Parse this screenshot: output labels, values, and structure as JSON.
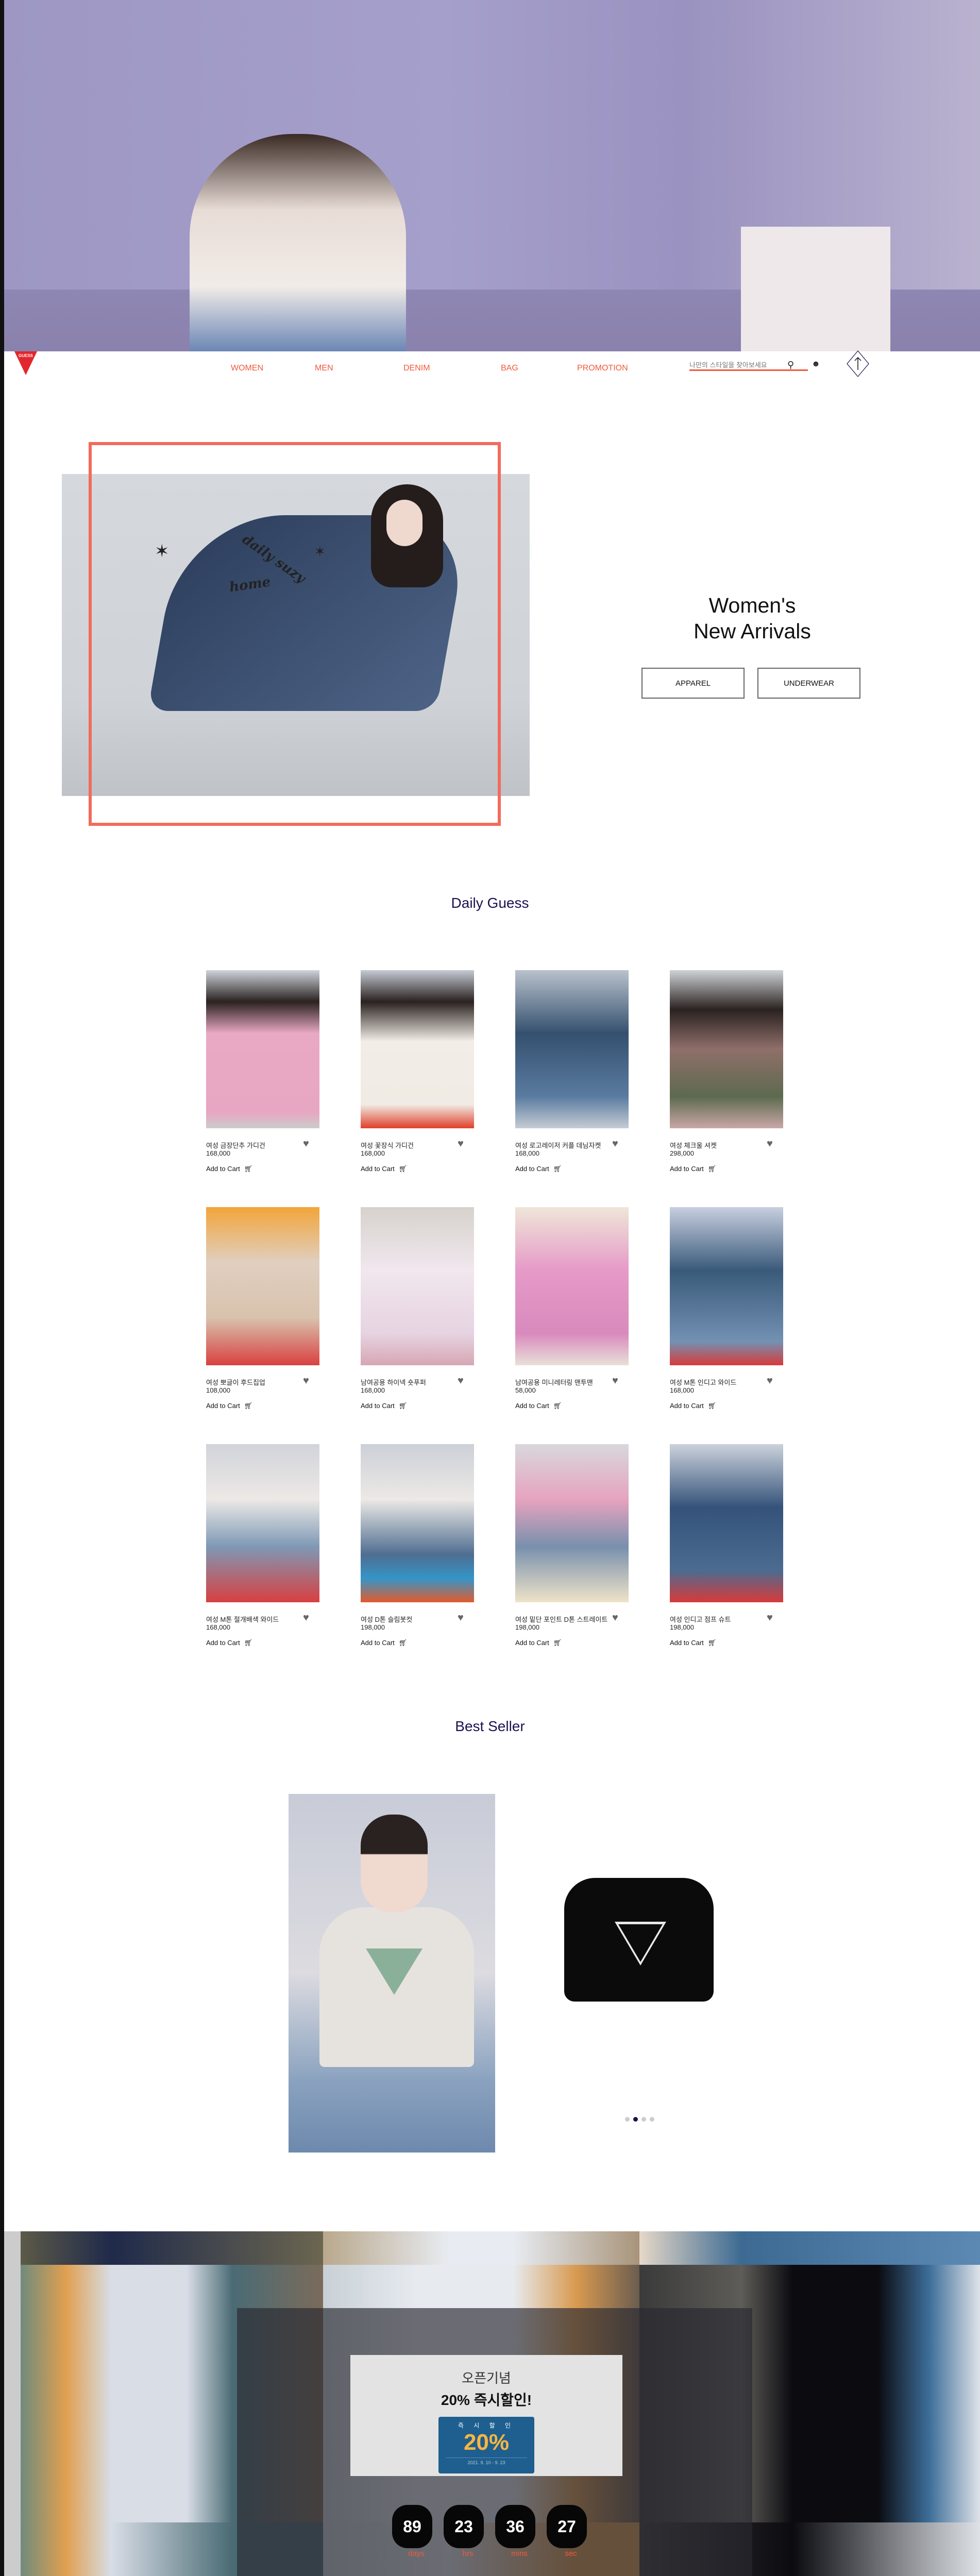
{
  "nav": {
    "logo_text": "GUESS",
    "items": [
      "WOMEN",
      "MEN",
      "DENIM",
      "BAG",
      "PROMOTION"
    ],
    "search_placeholder": "나만의 스타일을 찾아보세요",
    "icons": [
      "search-icon",
      "user-icon",
      "scroll-top-icon"
    ]
  },
  "hero": {
    "script_text_1": "daily suzy",
    "script_text_2": "home",
    "title_line1": "Women's",
    "title_line2": "New Arrivals",
    "buttons": [
      "APPAREL",
      "UNDERWEAR"
    ],
    "frame_color": "#f26b5b"
  },
  "daily": {
    "title": "Daily Guess",
    "add_to_cart": "Add to Cart",
    "products": [
      {
        "name": "여성 금장단추 가디건",
        "price": "168,000"
      },
      {
        "name": "여성 꽃장식 가디건",
        "price": "168,000"
      },
      {
        "name": "여성 로고레이저 커플 데님자켓",
        "price": "168,000"
      },
      {
        "name": "여성 체크울 셔켓",
        "price": "298,000"
      },
      {
        "name": "여성 뽀글이 후드집업",
        "price": "108,000"
      },
      {
        "name": "남여공용 하이넥 숏푸퍼",
        "price": "168,000"
      },
      {
        "name": "남여공용 미니레터링 맨투맨",
        "price": "58,000"
      },
      {
        "name": "여성 M톤 인디고 와이드",
        "price": "168,000"
      },
      {
        "name": "여성 M톤 절개배색 와이드",
        "price": "168,000"
      },
      {
        "name": "여성 D톤 슬림봇컷",
        "price": "198,000"
      },
      {
        "name": "여성 밑단 포인트 D톤 스트레이트",
        "price": "198,000"
      },
      {
        "name": "여성 인디고 점프 슈트",
        "price": "198,000"
      }
    ]
  },
  "best": {
    "title": "Best Seller",
    "slide_count": 4,
    "active_slide": 2
  },
  "promo": {
    "line1": "오픈기념",
    "line2": "20% 즉시할인!",
    "ticket_label": "즉 시 할 인",
    "ticket_value": "20%",
    "ticket_dates": "2021. 9. 10 - 9. 23",
    "countdown": [
      {
        "value": "89",
        "label": "days"
      },
      {
        "value": "23",
        "label": "hrs"
      },
      {
        "value": "36",
        "label": "mins"
      },
      {
        "value": "27",
        "label": "sec"
      }
    ]
  },
  "colors": {
    "accent": "#f05a3c",
    "title": "#1d1050",
    "ticket": "#1e5f8f"
  }
}
